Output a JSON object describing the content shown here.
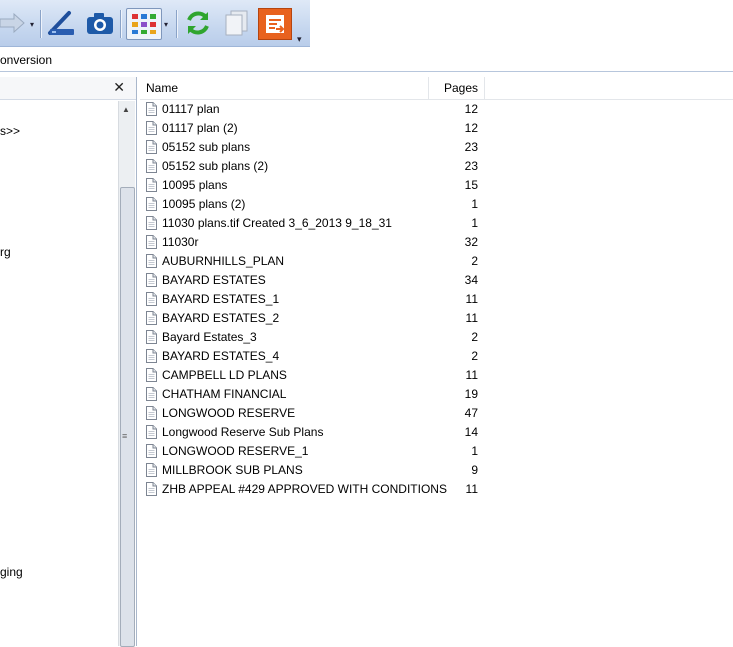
{
  "left_panel": {
    "items": [
      {
        "label": "s>>"
      },
      {
        "label": "rg"
      },
      {
        "label": "ging"
      }
    ]
  },
  "address": {
    "text": "onversion"
  },
  "columns": {
    "name": "Name",
    "pages": "Pages"
  },
  "files": [
    {
      "name": "01117 plan",
      "pages": "12"
    },
    {
      "name": "01117 plan (2)",
      "pages": "12"
    },
    {
      "name": "05152 sub plans",
      "pages": "23"
    },
    {
      "name": "05152 sub plans (2)",
      "pages": "23"
    },
    {
      "name": "10095 plans",
      "pages": "15"
    },
    {
      "name": "10095 plans (2)",
      "pages": "1"
    },
    {
      "name": "11030 plans.tif Created 3_6_2013 9_18_31",
      "pages": "1"
    },
    {
      "name": "11030r",
      "pages": "32"
    },
    {
      "name": "AUBURNHILLS_PLAN",
      "pages": "2"
    },
    {
      "name": "BAYARD ESTATES",
      "pages": "34"
    },
    {
      "name": "BAYARD ESTATES_1",
      "pages": "11"
    },
    {
      "name": "BAYARD ESTATES_2",
      "pages": "11"
    },
    {
      "name": "Bayard Estates_3",
      "pages": "2"
    },
    {
      "name": "BAYARD ESTATES_4",
      "pages": "2"
    },
    {
      "name": "CAMPBELL LD PLANS",
      "pages": "11"
    },
    {
      "name": "CHATHAM FINANCIAL",
      "pages": "19"
    },
    {
      "name": "LONGWOOD RESERVE",
      "pages": "47"
    },
    {
      "name": "Longwood Reserve Sub Plans",
      "pages": "14"
    },
    {
      "name": "LONGWOOD RESERVE_1",
      "pages": "1"
    },
    {
      "name": "MILLBROOK SUB PLANS",
      "pages": "9"
    },
    {
      "name": "ZHB APPEAL #429 APPROVED WITH CONDITIONS",
      "pages": "11"
    }
  ],
  "toolbar": {
    "icons": [
      "forward-arrow-icon",
      "scanner-icon",
      "camera-icon",
      "grid-view-icon",
      "refresh-icon",
      "copy-pages-icon",
      "convert-icon"
    ]
  },
  "colors": {
    "toolbar": "#c6d7ef",
    "accent_orange": "#e8621e",
    "refresh_green": "#2fa52f"
  }
}
